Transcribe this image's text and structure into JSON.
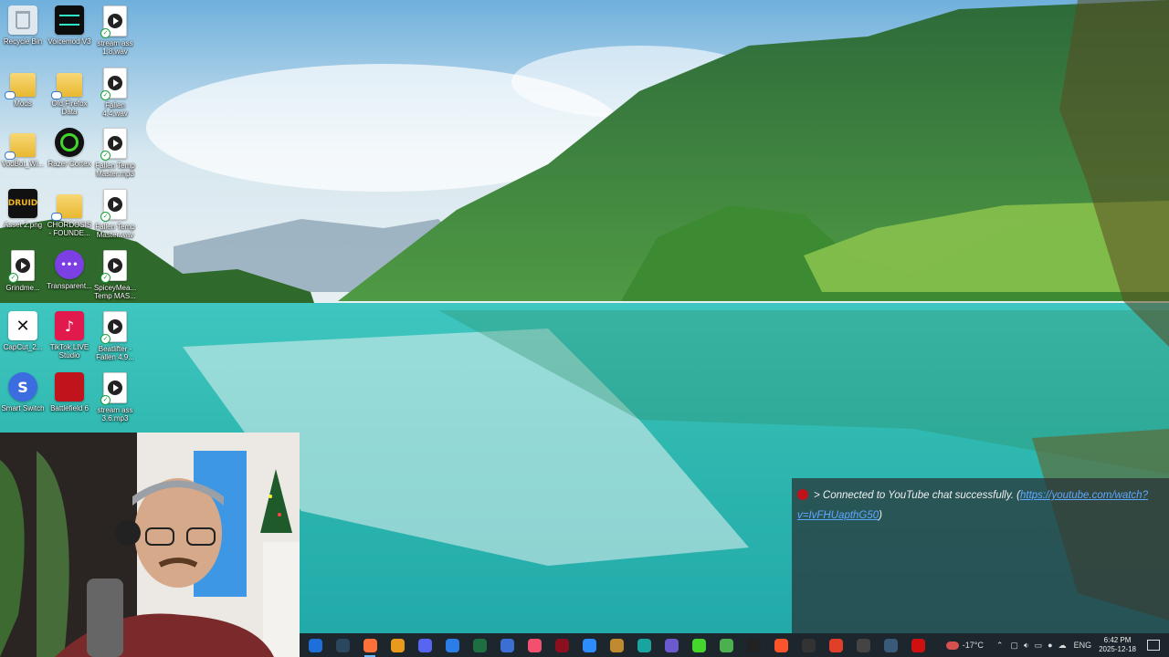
{
  "desktop": {
    "icons": [
      {
        "label": "Recycle Bin",
        "icon": "recycle-bin-icon"
      },
      {
        "label": "Voicemod V3",
        "icon": "voicemod-icon"
      },
      {
        "label": "stream ass\n1.8.wav",
        "icon": "audio-file-icon"
      },
      {
        "label": "Mods",
        "icon": "folder-icon"
      },
      {
        "label": "Old Firefox\nData",
        "icon": "folder-icon"
      },
      {
        "label": "Fallen\n4.4.wav",
        "icon": "audio-file-icon"
      },
      {
        "label": "VodBot_Wi...",
        "icon": "zip-folder-icon"
      },
      {
        "label": "Razer Cortex",
        "icon": "razer-cortex-icon"
      },
      {
        "label": "Fallen Temp\nMaster.mp3",
        "icon": "audio-file-icon"
      },
      {
        "label": "Asset 2.png",
        "icon": "image-file-icon"
      },
      {
        "label": "CHORDOSIS\n- FOUNDE...",
        "icon": "folder-icon"
      },
      {
        "label": "Fallen Temp\nMaster.wav",
        "icon": "audio-file-icon"
      },
      {
        "label": "Grindme...",
        "icon": "audio-file-icon"
      },
      {
        "label": "Transparent...",
        "icon": "chat-app-icon"
      },
      {
        "label": "SpiceyMea...\nTemp MAS...",
        "icon": "audio-file-icon"
      },
      {
        "label": "CapCut_2...",
        "icon": "capcut-icon"
      },
      {
        "label": "TikTok LIVE\nStudio",
        "icon": "tiktok-icon"
      },
      {
        "label": "Beatlifter -\nFallen 4.9...",
        "icon": "audio-file-icon"
      },
      {
        "label": "Smart Switch",
        "icon": "smart-switch-icon"
      },
      {
        "label": "Battlefield 6",
        "icon": "battlefield-icon"
      },
      {
        "label": "stream ass\n3.6.mp3",
        "icon": "audio-file-icon"
      }
    ]
  },
  "chat_overlay": {
    "message_prefix": "> Connected to YouTube chat successfully. (",
    "link_text": "https://youtube.com/watch?v=IvFHUapthG50",
    "message_suffix": ")"
  },
  "taskbar": {
    "apps": [
      {
        "name": "taskbar-app-1",
        "icon": "blue-app-icon",
        "color": "#1e6fd9"
      },
      {
        "name": "taskbar-steam",
        "icon": "steam-icon",
        "color": "#2a475e"
      },
      {
        "name": "taskbar-firefox",
        "icon": "firefox-icon",
        "color": "#ff7139",
        "active": true
      },
      {
        "name": "taskbar-app-4",
        "icon": "orange-app-icon",
        "color": "#e89a1c"
      },
      {
        "name": "taskbar-discord",
        "icon": "discord-icon",
        "color": "#5865f2"
      },
      {
        "name": "taskbar-app-6",
        "icon": "store-icon",
        "color": "#2b7de9"
      },
      {
        "name": "taskbar-excel",
        "icon": "excel-icon",
        "color": "#1d6f42"
      },
      {
        "name": "taskbar-docs",
        "icon": "docs-icon",
        "color": "#3b6fd4"
      },
      {
        "name": "taskbar-music",
        "icon": "music-icon",
        "color": "#f2506e"
      },
      {
        "name": "taskbar-app-10",
        "icon": "red-app-icon",
        "color": "#8a1020"
      },
      {
        "name": "taskbar-zoom",
        "icon": "zoom-icon",
        "color": "#2d8cff"
      },
      {
        "name": "taskbar-app-12",
        "icon": "image-app-icon",
        "color": "#c08a30"
      },
      {
        "name": "taskbar-edge",
        "icon": "edge-icon",
        "color": "#1aa4a0"
      },
      {
        "name": "taskbar-mic",
        "icon": "microphone-icon",
        "color": "#6a5acd"
      },
      {
        "name": "taskbar-razer",
        "icon": "razer-icon",
        "color": "#44d62c"
      },
      {
        "name": "taskbar-app-16",
        "icon": "green-app-icon",
        "color": "#4caf50"
      },
      {
        "name": "taskbar-capcut",
        "icon": "capcut-icon",
        "color": "#222222"
      },
      {
        "name": "taskbar-brave",
        "icon": "brave-icon",
        "color": "#fb542b"
      },
      {
        "name": "taskbar-app-19",
        "icon": "dark-app-icon",
        "color": "#333333"
      },
      {
        "name": "taskbar-app-20",
        "icon": "audio-app-icon",
        "color": "#e0402a"
      },
      {
        "name": "taskbar-app-21",
        "icon": "obs-icon",
        "color": "#444444"
      },
      {
        "name": "taskbar-app-22",
        "icon": "steam-alt-icon",
        "color": "#3a5a7a"
      },
      {
        "name": "taskbar-app-23",
        "icon": "record-icon",
        "color": "#d01010"
      }
    ],
    "weather": "-17°C",
    "language": "ENG",
    "time": "6:42 PM",
    "date": "2025-12-18"
  }
}
